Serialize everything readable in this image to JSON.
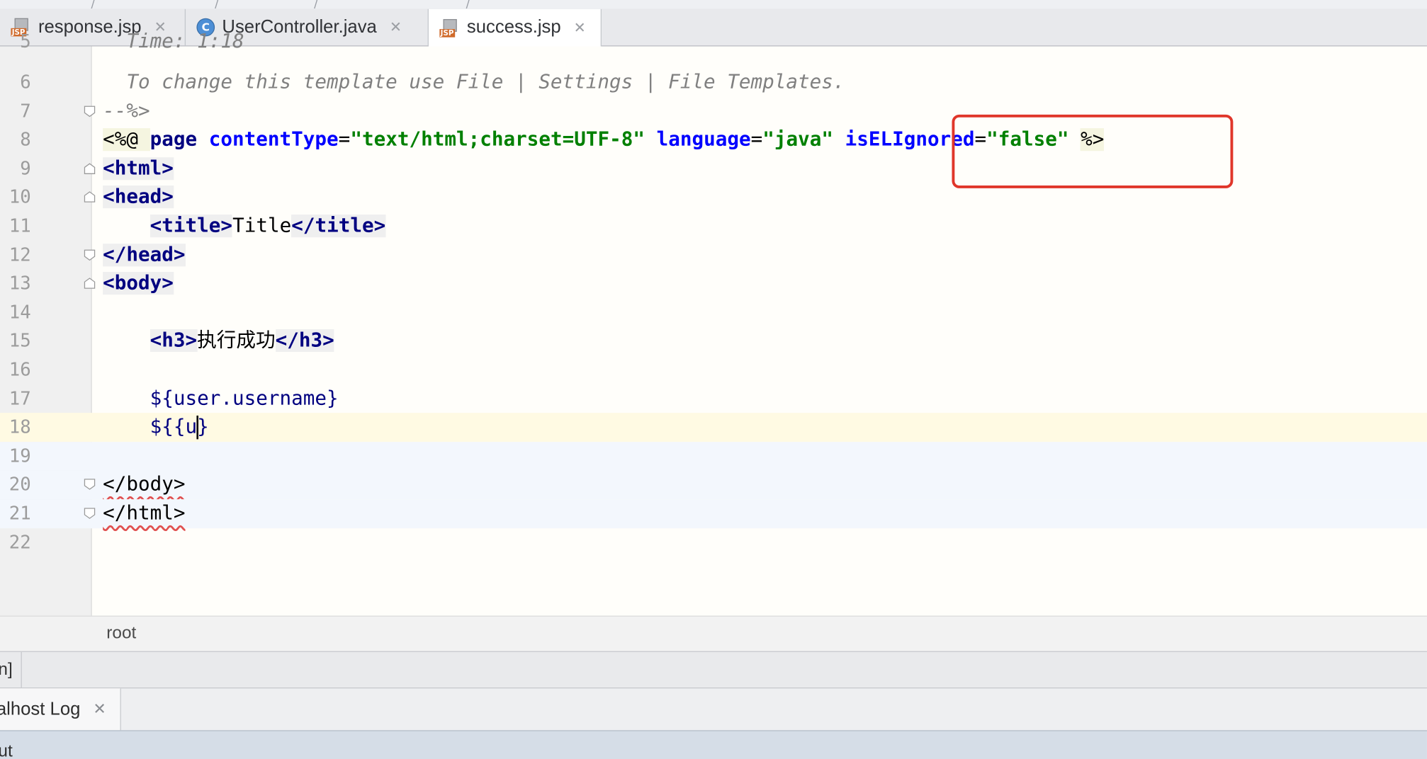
{
  "tabs": [
    {
      "name": "response.jsp",
      "icon": "jsp-file-icon",
      "active": false
    },
    {
      "name": "UserController.java",
      "icon": "java-class-icon",
      "active": false
    },
    {
      "name": "success.jsp",
      "icon": "jsp-file-icon",
      "active": true
    }
  ],
  "editor": {
    "line_numbers": [
      "5",
      "6",
      "7",
      "8",
      "9",
      "10",
      "11",
      "12",
      "13",
      "14",
      "15",
      "16",
      "17",
      "18",
      "19",
      "20",
      "21",
      "22"
    ],
    "lines": {
      "l5": "  Time: 1:18",
      "l6": "  To change this template use File | Settings | File Templates.",
      "l7": "--%>",
      "l8_dir_open": "<%@ ",
      "l8_page": "page ",
      "l8_ct_attr": "contentType",
      "l8_ct_val": "\"text/html;charset=UTF-8\"",
      "l8_lang_attr": "language",
      "l8_lang_val": "\"java\"",
      "l8_el_attr": "isELIgnored",
      "l8_el_val": "\"false\"",
      "l8_dir_close": "%>",
      "l9": "html",
      "l10": "head",
      "l11_tag": "title",
      "l11_text": "Title",
      "l12": "head",
      "l13": "body",
      "l15_tag": "h3",
      "l15_text": "执行成功",
      "l17": "${user.username}",
      "l18_before_caret": "${{u",
      "l18_after_caret": "}",
      "l20": "</body>",
      "l21": "</html>"
    },
    "current_line": "18"
  },
  "breadcrumb": {
    "text": "root"
  },
  "panel_stub": {
    "text": "n]"
  },
  "log_tab": {
    "label": "alhost Log"
  },
  "status": {
    "text": "ut"
  },
  "colors": {
    "highlight_box": "#e0362a",
    "tag": "#000080",
    "attribute": "#0000ff",
    "string": "#008000",
    "comment": "#808080"
  }
}
